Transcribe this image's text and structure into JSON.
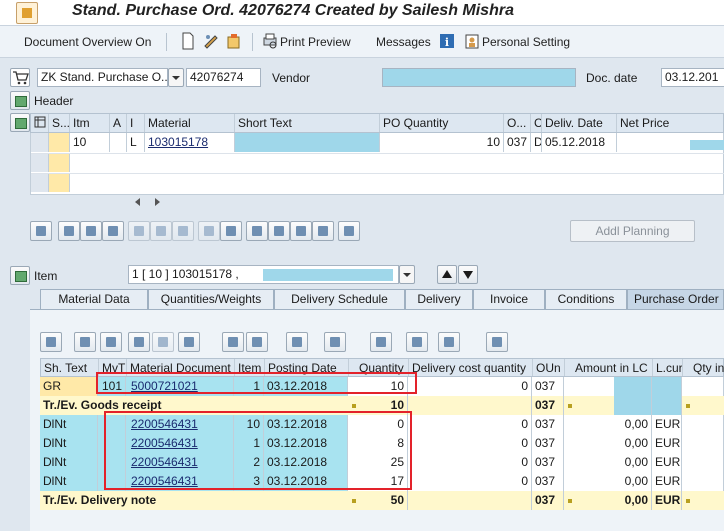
{
  "window": {
    "title": "Stand. Purchase Ord. 42076274 Created by Sailesh Mishra"
  },
  "toolbar": {
    "document_overview": "Document Overview On",
    "print_preview": "Print Preview",
    "messages": "Messages",
    "personal_setting": "Personal Setting"
  },
  "header": {
    "doc_type": "ZK Stand. Purchase O...",
    "po_number": "42076274",
    "vendor_label": "Vendor",
    "doc_date_label": "Doc. date",
    "doc_date": "03.12.201",
    "header_label": "Header"
  },
  "items_grid": {
    "columns": [
      "S...",
      "Itm",
      "A",
      "I",
      "Material",
      "Short Text",
      "PO Quantity",
      "O...",
      "C",
      "Deliv. Date",
      "Net Price"
    ],
    "rows": [
      {
        "itm": "10",
        "a": "",
        "i": "L",
        "material": "103015178",
        "po_qty": "10",
        "oun": "037",
        "c": "D",
        "deliv_date": "05.12.2018"
      }
    ]
  },
  "addl_planning": "Addl Planning",
  "item_section": {
    "label": "Item",
    "selector": "1 [ 10 ] 103015178 ,"
  },
  "tabs": [
    "Material Data",
    "Quantities/Weights",
    "Delivery Schedule",
    "Delivery",
    "Invoice",
    "Conditions",
    "Purchase Order"
  ],
  "history_grid": {
    "columns": [
      "Sh. Text",
      "MvT",
      "Material Document",
      "Item",
      "Posting Date",
      "Quantity",
      "Delivery cost quantity",
      "OUn",
      "Amount in LC",
      "L.cur",
      "Qty in"
    ],
    "rows": [
      {
        "sh": "GR",
        "mvt": "101",
        "doc": "5000721021",
        "item": "1",
        "date": "03.12.2018",
        "qty": "10",
        "dcq": "0",
        "oun": "037",
        "amt": "",
        "lcur": ""
      },
      {
        "sh": "Tr./Ev. Goods receipt",
        "qty": "10",
        "oun": "037",
        "total": true
      },
      {
        "sh": "DlNt",
        "mvt": "",
        "doc": "2200546431",
        "item": "10",
        "date": "03.12.2018",
        "qty": "0",
        "dcq": "0",
        "oun": "037",
        "amt": "0,00",
        "lcur": "EUR"
      },
      {
        "sh": "DlNt",
        "mvt": "",
        "doc": "2200546431",
        "item": "1",
        "date": "03.12.2018",
        "qty": "8",
        "dcq": "0",
        "oun": "037",
        "amt": "0,00",
        "lcur": "EUR"
      },
      {
        "sh": "DlNt",
        "mvt": "",
        "doc": "2200546431",
        "item": "2",
        "date": "03.12.2018",
        "qty": "25",
        "dcq": "0",
        "oun": "037",
        "amt": "0,00",
        "lcur": "EUR"
      },
      {
        "sh": "DlNt",
        "mvt": "",
        "doc": "2200546431",
        "item": "3",
        "date": "03.12.2018",
        "qty": "17",
        "dcq": "0",
        "oun": "037",
        "amt": "0,00",
        "lcur": "EUR"
      },
      {
        "sh": "Tr./Ev. Delivery note",
        "qty": "50",
        "oun": "037",
        "amt": "0,00",
        "lcur": "EUR",
        "total": true
      }
    ]
  },
  "colors": {
    "highlight_box": "#e3222a",
    "masked_field": "#9fd7ea",
    "total_row": "#fff8cc"
  }
}
